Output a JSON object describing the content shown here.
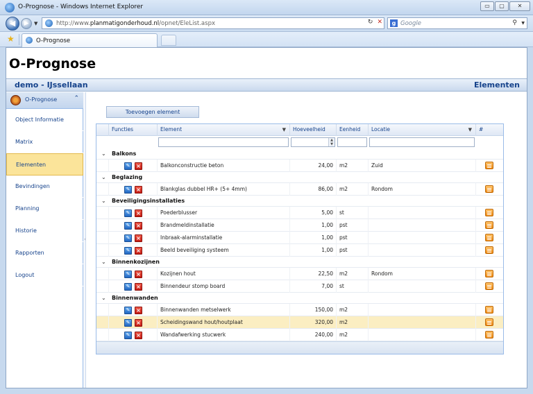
{
  "window": {
    "title": "O-Prognose - Windows Internet Explorer",
    "controls": {
      "minimize": "▭",
      "maximize": "▢",
      "close": "✕"
    }
  },
  "address": {
    "url_prefix": "http://www.",
    "url_host": "planmatigonderhoud.nl",
    "url_path": "/opnet/EleList.aspx",
    "search_placeholder": "Google"
  },
  "tabs": {
    "active_label": "O-Prognose"
  },
  "site": {
    "title": "O-Prognose",
    "context": "demo - IJssellaan",
    "section": "Elementen"
  },
  "sidebar": {
    "header": "O-Prognose",
    "items": [
      {
        "label": "Object Informatie"
      },
      {
        "label": "Matrix"
      },
      {
        "label": "Elementen",
        "active": true
      },
      {
        "label": "Bevindingen"
      },
      {
        "label": "Planning"
      },
      {
        "label": "Historie"
      },
      {
        "label": "Rapporten"
      },
      {
        "label": "Logout"
      }
    ]
  },
  "toolbar": {
    "add_label": "Toevoegen element"
  },
  "grid": {
    "columns": [
      "Functies",
      "Element",
      "Hoeveelheid",
      "Eenheid",
      "Locatie",
      "#"
    ],
    "groups": [
      {
        "name": "Balkons",
        "rows": [
          {
            "element": "Balkonconstructie beton",
            "qty": "24,00",
            "unit": "m2",
            "loc": "Zuid"
          }
        ]
      },
      {
        "name": "Beglazing",
        "rows": [
          {
            "element": "Blankglas dubbel HR+ (5+ 4mm)",
            "qty": "86,00",
            "unit": "m2",
            "loc": "Rondom"
          }
        ]
      },
      {
        "name": "Beveiligingsinstallaties",
        "rows": [
          {
            "element": "Poederblusser",
            "qty": "5,00",
            "unit": "st",
            "loc": ""
          },
          {
            "element": "Brandmeldinstallatie",
            "qty": "1,00",
            "unit": "pst",
            "loc": ""
          },
          {
            "element": "Inbraak-alarminstallatie",
            "qty": "1,00",
            "unit": "pst",
            "loc": ""
          },
          {
            "element": "Beeld beveiliging systeem",
            "qty": "1,00",
            "unit": "pst",
            "loc": ""
          }
        ]
      },
      {
        "name": "Binnenkozijnen",
        "rows": [
          {
            "element": "Kozijnen hout",
            "qty": "22,50",
            "unit": "m2",
            "loc": "Rondom"
          },
          {
            "element": "Binnendeur stomp board",
            "qty": "7,00",
            "unit": "st",
            "loc": ""
          }
        ]
      },
      {
        "name": "Binnenwanden",
        "rows": [
          {
            "element": "Binnenwanden metselwerk",
            "qty": "150,00",
            "unit": "m2",
            "loc": ""
          },
          {
            "element": "Scheidingswand hout/houtplaat",
            "qty": "320,00",
            "unit": "m2",
            "loc": "",
            "selected": true
          },
          {
            "element": "Wandafwerking stucwerk",
            "qty": "240,00",
            "unit": "m2",
            "loc": ""
          }
        ]
      }
    ]
  }
}
